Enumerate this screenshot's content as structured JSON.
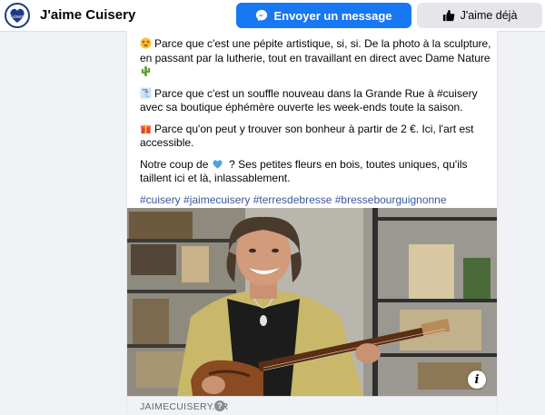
{
  "page": {
    "name": "J'aime Cuisery",
    "avatar_text": "Cuisery",
    "message_button": "Envoyer un message",
    "like_button": "J'aime déjà"
  },
  "post": {
    "p1": "Parce que c'est une pépite artistique, si, si. De la photo à la sculpture, en passant par la lutherie, tout en travaillant en direct avec Dame Nature",
    "p2": "Parce que c'est un souffle nouveau dans la Grande Rue à #cuisery avec sa boutique éphémère ouverte les week-ends toute la saison.",
    "p3": "Parce qu'on peut y trouver son bonheur à partir de 2 €. Ici, l'art est accessible.",
    "p4_start": "Notre coup de",
    "p4_end": "? Ses petites fleurs en bois, toutes uniques, qu'ils taillent ici et là, inlassablement.",
    "hashtags": "#cuisery #jaimecuisery #terresdebresse #bressebourguignonne"
  },
  "link": {
    "domain": "JAIMECUISERY.FR",
    "info_icon": "i",
    "help_icon": "?"
  },
  "icons": {
    "messenger": "messenger-icon",
    "thumbs_up": "thumbs-up-icon",
    "star_struck": "star-struck-emoji",
    "cactus": "cactus-emoji",
    "shower": "shower-emoji",
    "gift": "gift-emoji",
    "blue_heart": "blue-heart-emoji"
  },
  "colors": {
    "accent": "#1877f2",
    "hashtag": "#385898",
    "background": "#f0f2f5"
  }
}
